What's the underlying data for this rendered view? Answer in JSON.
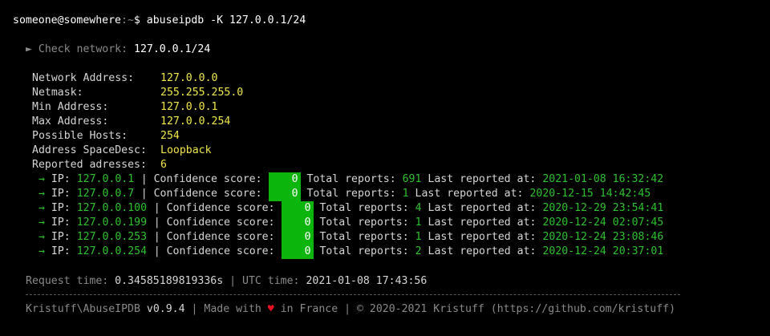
{
  "prompt": {
    "user": "someone@somewhere",
    "sep": ":",
    "path": "~",
    "symbol": "$ ",
    "command": "abuseipdb -K 127.0.0.1/24"
  },
  "check": {
    "arrow": "►",
    "label": "Check network:",
    "value": "127.0.0.1/24"
  },
  "network": [
    {
      "label": "Network Address:",
      "value": "127.0.0.0"
    },
    {
      "label": "Netmask:",
      "value": "255.255.255.0"
    },
    {
      "label": "Min Address:",
      "value": "127.0.0.1"
    },
    {
      "label": "Max Address:",
      "value": "127.0.0.254"
    },
    {
      "label": "Possible Hosts:",
      "value": "254"
    },
    {
      "label": "Address SpaceDesc:",
      "value": "Loopback"
    },
    {
      "label": "Reported adresses:",
      "value": "6"
    }
  ],
  "labels": {
    "arrow": "→",
    "ip": "IP:",
    "sep": "|",
    "confidence": "Confidence score:",
    "total": "Total reports:",
    "last": "Last reported at:"
  },
  "reports": [
    {
      "ip": "127.0.0.1",
      "score": "0",
      "total": "691",
      "date": "2021-01-08 16:32:42"
    },
    {
      "ip": "127.0.0.7",
      "score": "0",
      "total": "1",
      "date": "2020-12-15 14:42:45"
    },
    {
      "ip": "127.0.0.100",
      "score": "0",
      "total": "4",
      "date": "2020-12-29 23:54:41"
    },
    {
      "ip": "127.0.0.199",
      "score": "0",
      "total": "1",
      "date": "2020-12-24 02:07:45"
    },
    {
      "ip": "127.0.0.253",
      "score": "0",
      "total": "1",
      "date": "2020-12-24 23:08:46"
    },
    {
      "ip": "127.0.0.254",
      "score": "0",
      "total": "2",
      "date": "2020-12-24 20:37:01"
    }
  ],
  "request": {
    "label": "Request time:",
    "value": "0.34585189819336s",
    "sep": "|",
    "utc_label": "UTC time:",
    "utc_value": "2021-01-08 17:43:56"
  },
  "footer": {
    "app": "Kristuff\\AbuseIPDB",
    "version": "v0.9.4",
    "sep": "|",
    "made": "Made with",
    "heart": "♥",
    "in": "in France",
    "copy": "© 2020-2021 Kristuff (https://github.com/kristuff)"
  },
  "colors": {
    "background": "#000000",
    "label": "#d6d6d6",
    "value_yellow": "#f0e64a",
    "value_green": "#2ec12e",
    "muted": "#8a8a8a",
    "score_bg": "#0cb50c",
    "heart": "#e81123"
  }
}
